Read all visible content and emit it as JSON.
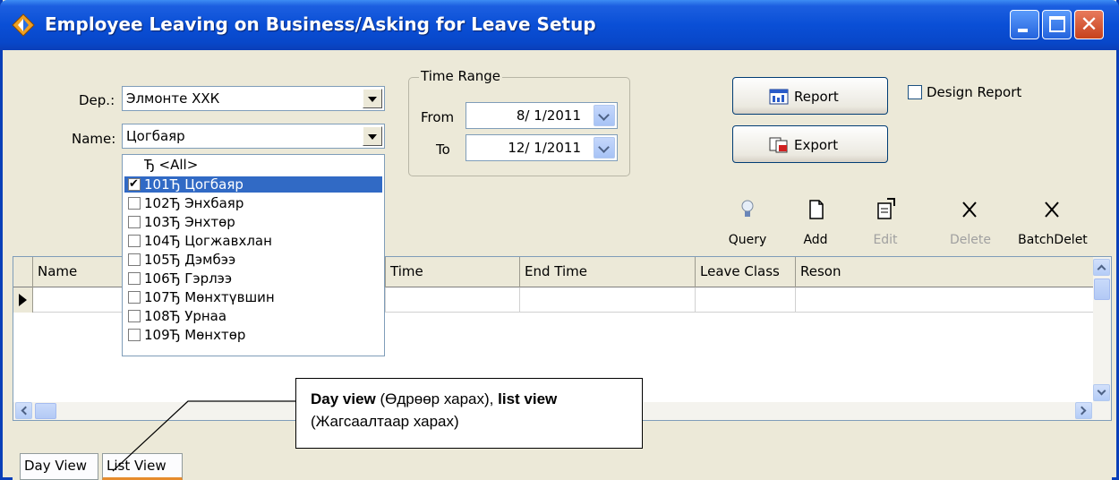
{
  "window": {
    "title": "Employee Leaving on Business/Asking for Leave Setup",
    "title_bar_color": "#0a4fd6"
  },
  "filters": {
    "dep_label": "Dep.:",
    "dep_value": "Элмонте ХХК",
    "name_label": "Name:",
    "name_value": "Цогбаяр"
  },
  "name_dropdown": {
    "items": [
      {
        "text": "Ђ <All>",
        "checked": false,
        "selected": false,
        "has_checkbox": false
      },
      {
        "text": "101Ђ  Цогбаяр",
        "checked": true,
        "selected": true,
        "has_checkbox": true
      },
      {
        "text": "102Ђ  Энхбаяр",
        "checked": false,
        "selected": false,
        "has_checkbox": true
      },
      {
        "text": "103Ђ  Энхтөр",
        "checked": false,
        "selected": false,
        "has_checkbox": true
      },
      {
        "text": "104Ђ  Цогжавхлан",
        "checked": false,
        "selected": false,
        "has_checkbox": true
      },
      {
        "text": "105Ђ  Дэмбээ",
        "checked": false,
        "selected": false,
        "has_checkbox": true
      },
      {
        "text": "106Ђ  Гэрлээ",
        "checked": false,
        "selected": false,
        "has_checkbox": true
      },
      {
        "text": "107Ђ  Мөнхтүвшин",
        "checked": false,
        "selected": false,
        "has_checkbox": true
      },
      {
        "text": "108Ђ  Урнаа",
        "checked": false,
        "selected": false,
        "has_checkbox": true
      },
      {
        "text": "109Ђ  Мөнхтөр",
        "checked": false,
        "selected": false,
        "has_checkbox": true
      }
    ]
  },
  "time_range": {
    "group_title": "Time Range",
    "from_label": "From",
    "from_value": "8/ 1/2011",
    "to_label": "To",
    "to_value": "12/ 1/2011"
  },
  "actions": {
    "report_label": "Report",
    "export_label": "Export",
    "design_report_label": "Design Report",
    "design_report_checked": false
  },
  "toolbar": {
    "query": "Query",
    "add": "Add",
    "edit": "Edit",
    "delete": "Delete",
    "batch_delete": "BatchDelet"
  },
  "grid": {
    "columns": [
      "Name",
      "Time",
      "End Time",
      "Leave Class",
      "Reson"
    ]
  },
  "tabs": {
    "day_view": "Day View",
    "list_view": "List View"
  },
  "callout": {
    "part1_bold": "Day view",
    "part2": " (Өдрөөр харах), ",
    "part3_bold": "list view",
    "part4": " (Жагсаалтаар харах)"
  }
}
